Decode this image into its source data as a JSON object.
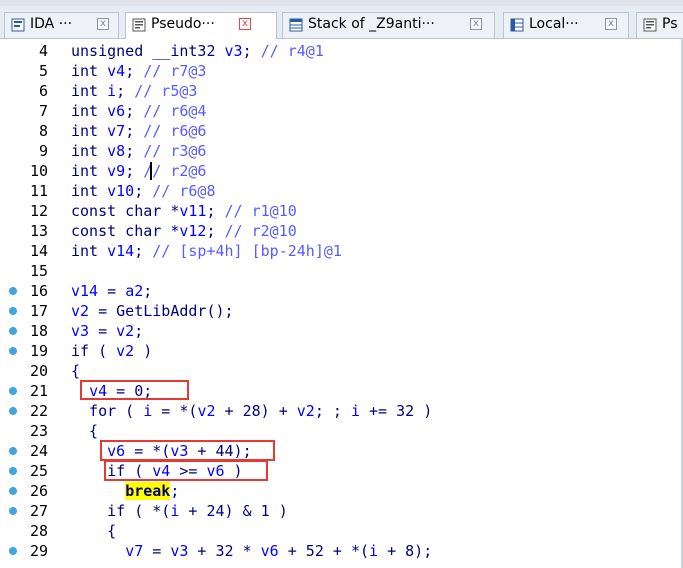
{
  "tabs": [
    {
      "label": "IDA ···",
      "icon": "ida-view-icon",
      "active": false
    },
    {
      "label": "Pseudo···",
      "icon": "pseudocode-icon",
      "active": true
    },
    {
      "label": "Stack of _Z9anti···",
      "icon": "stack-frame-icon",
      "active": false
    },
    {
      "label": "Local···",
      "icon": "local-types-icon",
      "active": false
    },
    {
      "label": "Ps",
      "icon": "pseudocode-icon",
      "active": false
    }
  ],
  "close_glyph": "x",
  "colors": {
    "keyword": "#000080",
    "variable": "#0000ff",
    "comment": "#5a5aff",
    "breakpoint": "#42a5e0",
    "highlight_box": "#e53935",
    "highlight_bg": "#ffff00"
  },
  "lines": [
    {
      "n": "4",
      "bp": false,
      "p": [
        [
          "k",
          "unsigned __int32 "
        ],
        [
          "v",
          "v3"
        ],
        [
          "k",
          "; "
        ],
        [
          "c",
          "// r4@1"
        ]
      ]
    },
    {
      "n": "5",
      "bp": false,
      "p": [
        [
          "k",
          "int "
        ],
        [
          "v",
          "v4"
        ],
        [
          "k",
          "; "
        ],
        [
          "c",
          "// r7@3"
        ]
      ]
    },
    {
      "n": "6",
      "bp": false,
      "p": [
        [
          "k",
          "int "
        ],
        [
          "v",
          "i"
        ],
        [
          "k",
          "; "
        ],
        [
          "c",
          "// r5@3"
        ]
      ]
    },
    {
      "n": "7",
      "bp": false,
      "p": [
        [
          "k",
          "int "
        ],
        [
          "v",
          "v6"
        ],
        [
          "k",
          "; "
        ],
        [
          "c",
          "// r6@4"
        ]
      ]
    },
    {
      "n": "8",
      "bp": false,
      "p": [
        [
          "k",
          "int "
        ],
        [
          "v",
          "v7"
        ],
        [
          "k",
          "; "
        ],
        [
          "c",
          "// r6@6"
        ]
      ]
    },
    {
      "n": "9",
      "bp": false,
      "p": [
        [
          "k",
          "int "
        ],
        [
          "v",
          "v8"
        ],
        [
          "k",
          "; "
        ],
        [
          "c",
          "// r3@6"
        ]
      ]
    },
    {
      "n": "10",
      "bp": false,
      "p": [
        [
          "k",
          "int "
        ],
        [
          "v",
          "v9"
        ],
        [
          "k",
          "; "
        ],
        [
          "c",
          "// r2@6"
        ]
      ]
    },
    {
      "n": "11",
      "bp": false,
      "p": [
        [
          "k",
          "int "
        ],
        [
          "v",
          "v10"
        ],
        [
          "k",
          "; "
        ],
        [
          "c",
          "// r6@8"
        ]
      ]
    },
    {
      "n": "12",
      "bp": false,
      "p": [
        [
          "k",
          "const char *"
        ],
        [
          "v",
          "v11"
        ],
        [
          "k",
          "; "
        ],
        [
          "c",
          "// r1@10"
        ]
      ]
    },
    {
      "n": "13",
      "bp": false,
      "p": [
        [
          "k",
          "const char *"
        ],
        [
          "v",
          "v12"
        ],
        [
          "k",
          "; "
        ],
        [
          "c",
          "// r2@10"
        ]
      ]
    },
    {
      "n": "14",
      "bp": false,
      "p": [
        [
          "k",
          "int "
        ],
        [
          "v",
          "v14"
        ],
        [
          "k",
          "; "
        ],
        [
          "c",
          "// [sp+4h] [bp-24h]@1"
        ]
      ]
    },
    {
      "n": "15",
      "bp": false,
      "p": []
    },
    {
      "n": "16",
      "bp": true,
      "p": [
        [
          "v",
          "v14"
        ],
        [
          "k",
          " = "
        ],
        [
          "v",
          "a2"
        ],
        [
          "k",
          ";"
        ]
      ]
    },
    {
      "n": "17",
      "bp": true,
      "p": [
        [
          "v",
          "v2"
        ],
        [
          "k",
          " = GetLibAddr();"
        ]
      ]
    },
    {
      "n": "18",
      "bp": true,
      "p": [
        [
          "v",
          "v3"
        ],
        [
          "k",
          " = "
        ],
        [
          "v",
          "v2"
        ],
        [
          "k",
          ";"
        ]
      ]
    },
    {
      "n": "19",
      "bp": true,
      "p": [
        [
          "k",
          "if ( "
        ],
        [
          "v",
          "v2"
        ],
        [
          "k",
          " )"
        ]
      ]
    },
    {
      "n": "20",
      "bp": false,
      "p": [
        [
          "k",
          "{"
        ]
      ]
    },
    {
      "n": "21",
      "bp": true,
      "p": [
        [
          "k",
          "  "
        ],
        [
          "v",
          "v4"
        ],
        [
          "k",
          " = 0;"
        ]
      ]
    },
    {
      "n": "22",
      "bp": true,
      "p": [
        [
          "k",
          "  for ( "
        ],
        [
          "v",
          "i"
        ],
        [
          "k",
          " = *("
        ],
        [
          "v",
          "v2"
        ],
        [
          "k",
          " + 28) + "
        ],
        [
          "v",
          "v2"
        ],
        [
          "k",
          "; ; "
        ],
        [
          "v",
          "i"
        ],
        [
          "k",
          " += 32 )"
        ]
      ]
    },
    {
      "n": "23",
      "bp": false,
      "p": [
        [
          "k",
          "  {"
        ]
      ]
    },
    {
      "n": "24",
      "bp": true,
      "p": [
        [
          "k",
          "    "
        ],
        [
          "v",
          "v6"
        ],
        [
          "k",
          " = *("
        ],
        [
          "v",
          "v3"
        ],
        [
          "k",
          " + 44);"
        ]
      ]
    },
    {
      "n": "25",
      "bp": true,
      "p": [
        [
          "k",
          "    if ( "
        ],
        [
          "v",
          "v4"
        ],
        [
          "k",
          " >= "
        ],
        [
          "v",
          "v6"
        ],
        [
          "k",
          " )"
        ]
      ]
    },
    {
      "n": "26",
      "bp": true,
      "p": [
        [
          "k",
          "      "
        ],
        [
          "hl",
          "break"
        ],
        [
          "k",
          ";"
        ]
      ]
    },
    {
      "n": "27",
      "bp": true,
      "p": [
        [
          "k",
          "    if ( *("
        ],
        [
          "v",
          "i"
        ],
        [
          "k",
          " + 24) & 1 )"
        ]
      ]
    },
    {
      "n": "28",
      "bp": false,
      "p": [
        [
          "k",
          "    {"
        ]
      ]
    },
    {
      "n": "29",
      "bp": true,
      "p": [
        [
          "k",
          "      "
        ],
        [
          "v",
          "v7"
        ],
        [
          "k",
          " = "
        ],
        [
          "v",
          "v3"
        ],
        [
          "k",
          " + 32 * "
        ],
        [
          "v",
          "v6"
        ],
        [
          "k",
          " + 52 + *("
        ],
        [
          "v",
          "i"
        ],
        [
          "k",
          " + 8);"
        ]
      ]
    }
  ]
}
